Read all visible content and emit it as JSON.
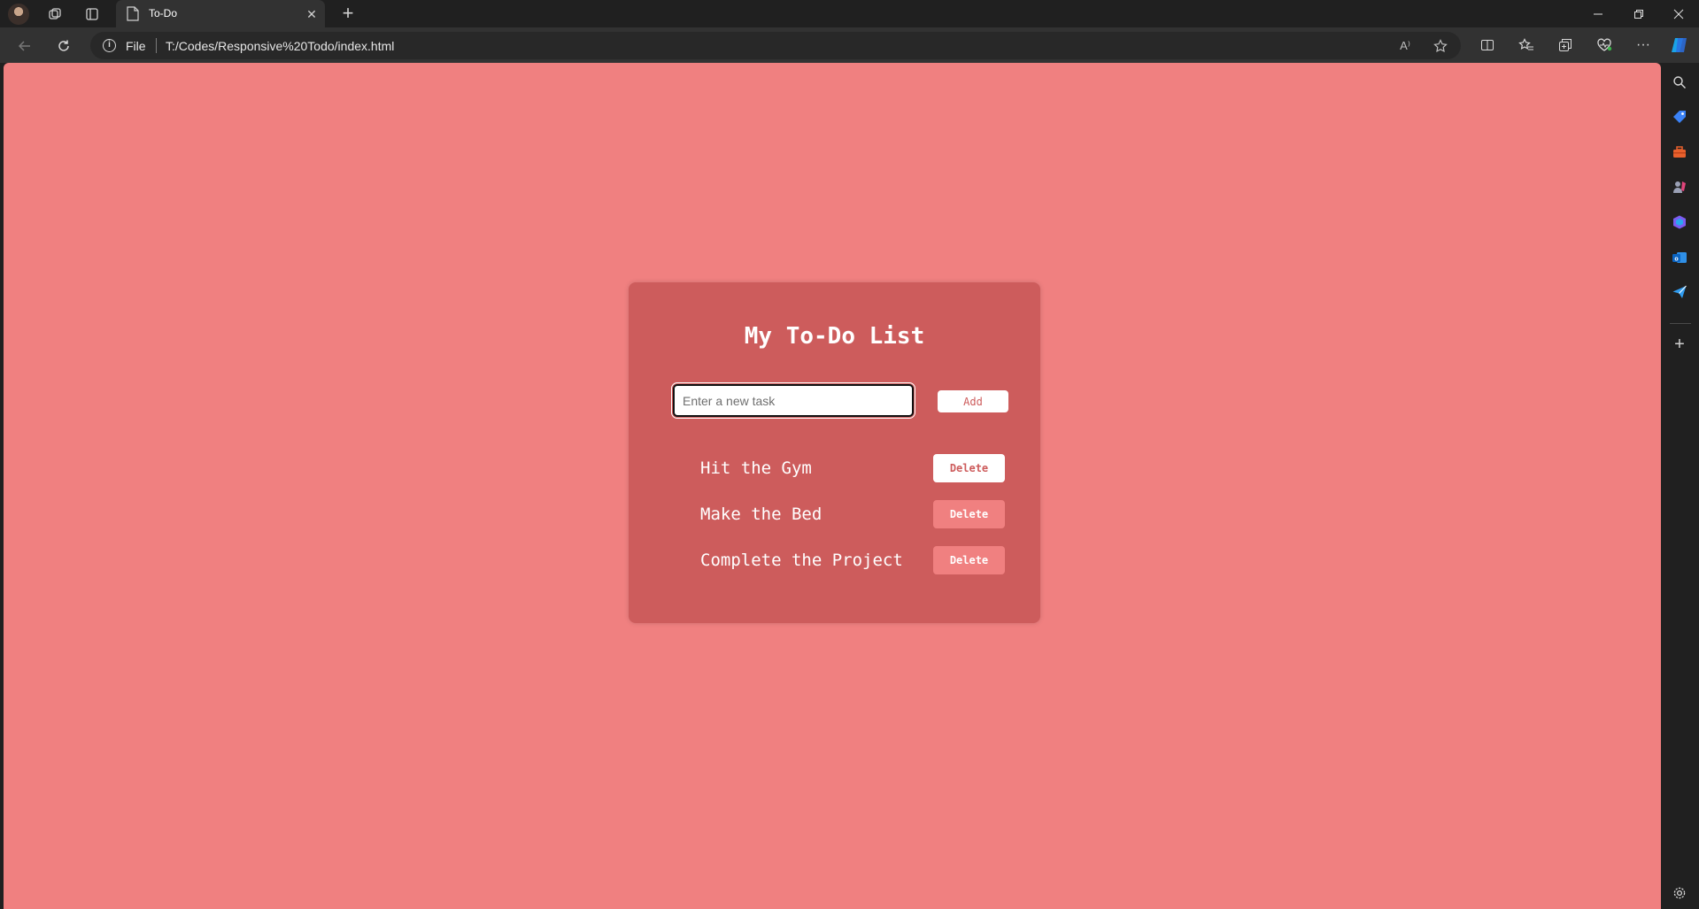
{
  "browser": {
    "tab_title": "To-Do",
    "tab_close": "✕",
    "new_tab": "+",
    "address_scheme": "File",
    "address_url": "T:/Codes/Responsive%20Todo/index.html",
    "read_aloud": "A⁾",
    "more": "···",
    "sidebar_add": "+"
  },
  "page": {
    "background_color": "#f08080",
    "card_color": "#cd5c5c",
    "title": "My To-Do List",
    "input": {
      "value": "",
      "placeholder": "Enter a new task"
    },
    "add_label": "Add",
    "tasks": [
      {
        "text": "Hit the Gym",
        "delete_label": "Delete"
      },
      {
        "text": "Make the Bed",
        "delete_label": "Delete"
      },
      {
        "text": "Complete the Project",
        "delete_label": "Delete"
      }
    ]
  }
}
